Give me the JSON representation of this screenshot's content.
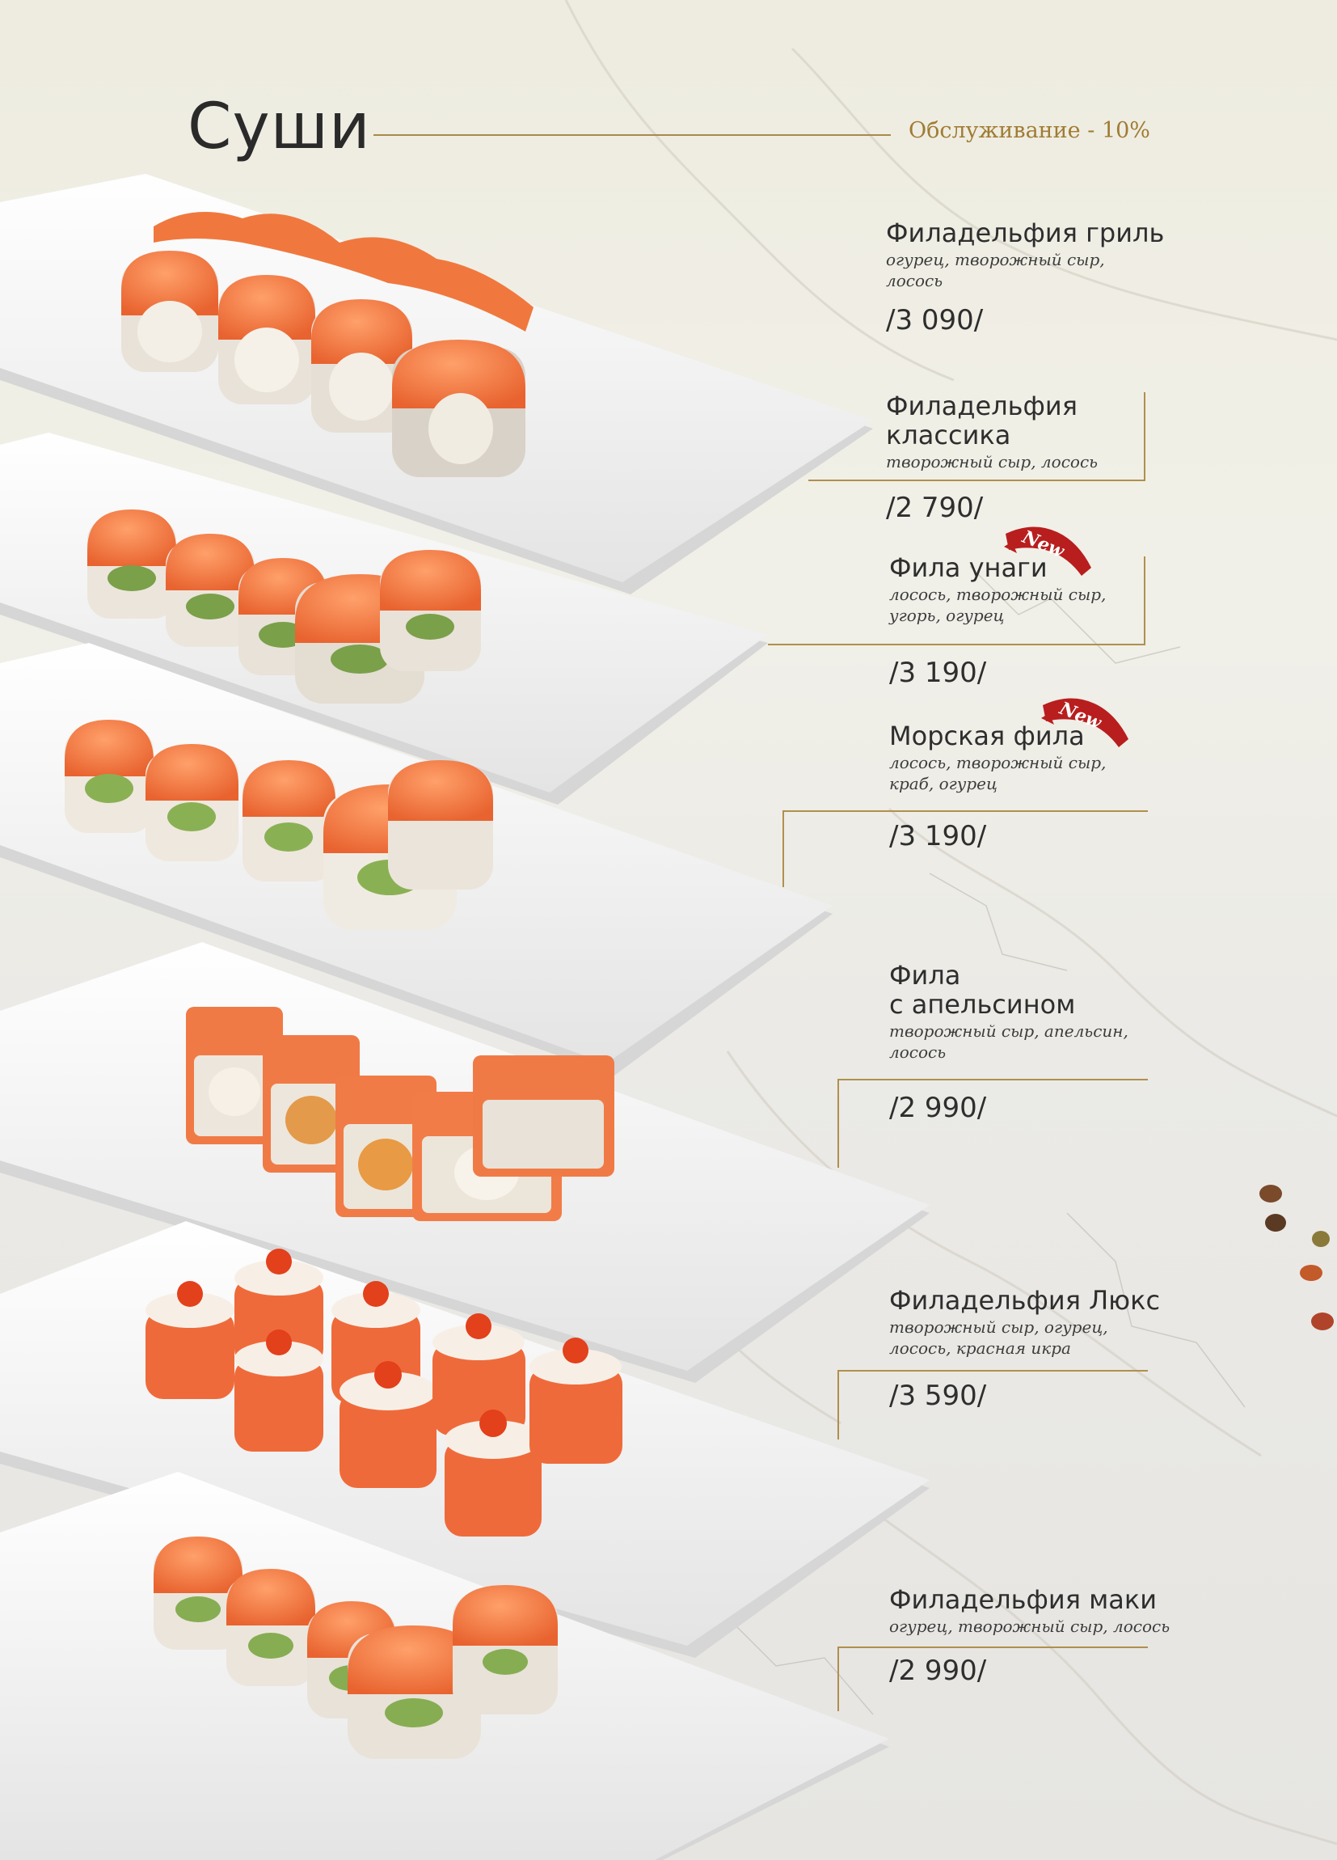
{
  "header": {
    "title": "Суши",
    "service_note": "Обслуживание - 10%"
  },
  "badge_label": "New",
  "items": [
    {
      "name": "Филадельфия гриль",
      "description": "огурец, творожный сыр,\nлосось",
      "price": "/3 090/",
      "is_new": false
    },
    {
      "name": "Филадельфия\nклассика",
      "description": "творожный сыр, лосось",
      "price": "/2 790/",
      "is_new": false
    },
    {
      "name": "Фила унаги",
      "description": "лосось, творожный сыр,\nугорь, огурец",
      "price": "/3 190/",
      "is_new": true
    },
    {
      "name": "Морская фила",
      "description": "лосось, творожный сыр,\nкраб, огурец",
      "price": "/3 190/",
      "is_new": true
    },
    {
      "name": "Фила\nс апельсином",
      "description": "творожный сыр, апельсин,\nлосось",
      "price": "/2 990/",
      "is_new": false
    },
    {
      "name": "Филадельфия Люкс",
      "description": "творожный сыр, огурец,\nлосось, красная икра",
      "price": "/3 590/",
      "is_new": false
    },
    {
      "name": "Филадельфия маки",
      "description": "огурец, творожный сыр, лосось",
      "price": "/2 990/",
      "is_new": false
    }
  ],
  "colors": {
    "accent_gold": "#a07c33",
    "badge_red": "#b81e1e",
    "salmon": "#f07a45"
  }
}
